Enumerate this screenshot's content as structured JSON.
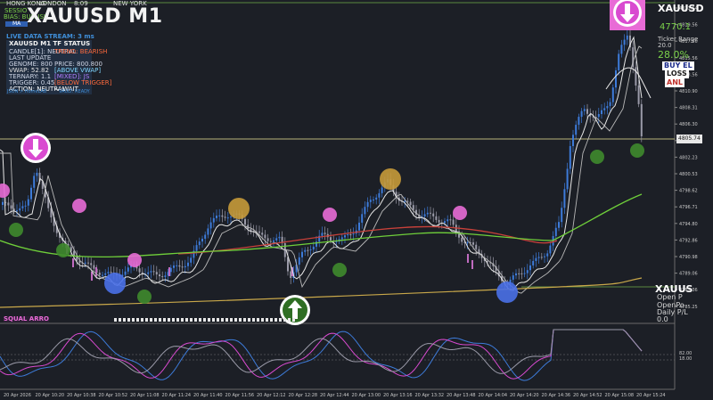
{
  "sessions": {
    "hong_kong": "HONG KONG",
    "london": "LONDON",
    "time": "8:09",
    "new_york": "NEW YORK"
  },
  "title": "XAUUSD M1",
  "sessions_label": "SESSIO",
  "bias": "BIAS: BULLISH",
  "ma_label": "MA",
  "status_panel": {
    "stream": "LIVE DATA STREAM: 3 ms",
    "heading": "XAUUSD M1 TF STATUS",
    "rows": [
      {
        "left": "CANDLE[1]: NEUTRAL",
        "right": "TREND: BEARISH",
        "lc": "#cfd6e6",
        "rc": "#ff6a3d"
      },
      {
        "left": "LAST UPDATE",
        "right": "",
        "lc": "#cfd6e6",
        "rc": "#ff6a3d"
      },
      {
        "left": "GENOME: 800",
        "right": "PRICE: 800.800",
        "lc": "#cfd6e6",
        "rc": "#cfd6e6"
      },
      {
        "left": "VWAP: 52.82",
        "right": "[ABOVE VWAP]",
        "lc": "#e0e0e0",
        "rc": "#7fd6ff"
      },
      {
        "left": "TERNARY: 1.1",
        "right": "[MIXED]: JS",
        "lc": "#cfd6e6",
        "rc": "#b07cff"
      },
      {
        "left": "TRIGGER: 0.45",
        "right": "[BELOW TRIGGER]",
        "lc": "#cfd6e6",
        "rc": "#ff6a3d"
      },
      {
        "left": "ACTION: NEUTRAL",
        "right": "— WAIT",
        "lc": "#ffffff",
        "rc": "#ffffff"
      }
    ],
    "json_line": "JSON > HomeLAB",
    "vault": "VAULT: READY"
  },
  "right_panel": {
    "symbol": "XAUUSD",
    "big_value": "4770.1",
    "line3": "Ticker Range",
    "line4": "20.0",
    "pct": "28.0%",
    "buy": "BUY EL",
    "loss": "LOSS",
    "anl": "ANL"
  },
  "right_panel_2": {
    "symbol": "XAUUS",
    "open": "Open P",
    "open2": "OpenPo",
    "daily": "Daily P/L",
    "val": "0.0"
  },
  "squares_label": "SQUAL ARRO",
  "current_price_tag": "4805.74",
  "price_axis": [
    "4821.54",
    "4819.56",
    "4817.56",
    "4815.56",
    "4813.56",
    "4810.90",
    "4808.31",
    "4806.30",
    "4804.25",
    "4802.23",
    "4800.53",
    "4798.62",
    "4796.71",
    "4794.80",
    "4792.86",
    "4790.98",
    "4789.06",
    "4787.36",
    "4785.25"
  ],
  "osc_axis": [
    "82.00",
    "18.00"
  ],
  "time_axis": [
    "20 Apr 2026",
    "20 Apr 10:20",
    "20 Apr 10:38",
    "20 Apr 10:52",
    "20 Apr 11:08",
    "20 Apr 11:24",
    "20 Apr 11:40",
    "20 Apr 11:56",
    "20 Apr 12:12",
    "20 Apr 12:28",
    "20 Apr 12:44",
    "20 Apr 13:00",
    "20 Apr 13:16",
    "20 Apr 13:32",
    "20 Apr 13:48",
    "20 Apr 14:04",
    "20 Apr 14:20",
    "20 Apr 14:36",
    "20 Apr 14:52",
    "20 Apr 15:08",
    "20 Apr 15:24"
  ],
  "colors": {
    "bg": "#1c1f26",
    "bull": "#3d7bd9",
    "bear": "#9a9aa8",
    "pink_marker": "#e86bd6",
    "green_marker": "#3f8a2e",
    "blue_marker": "#4a70e8",
    "gold_marker": "#c79a3a",
    "ma_white": "#e8e8e8",
    "ma_green": "#6fcf3a",
    "ma_red": "#c9413a",
    "ma_gold": "#c9a84a"
  }
}
